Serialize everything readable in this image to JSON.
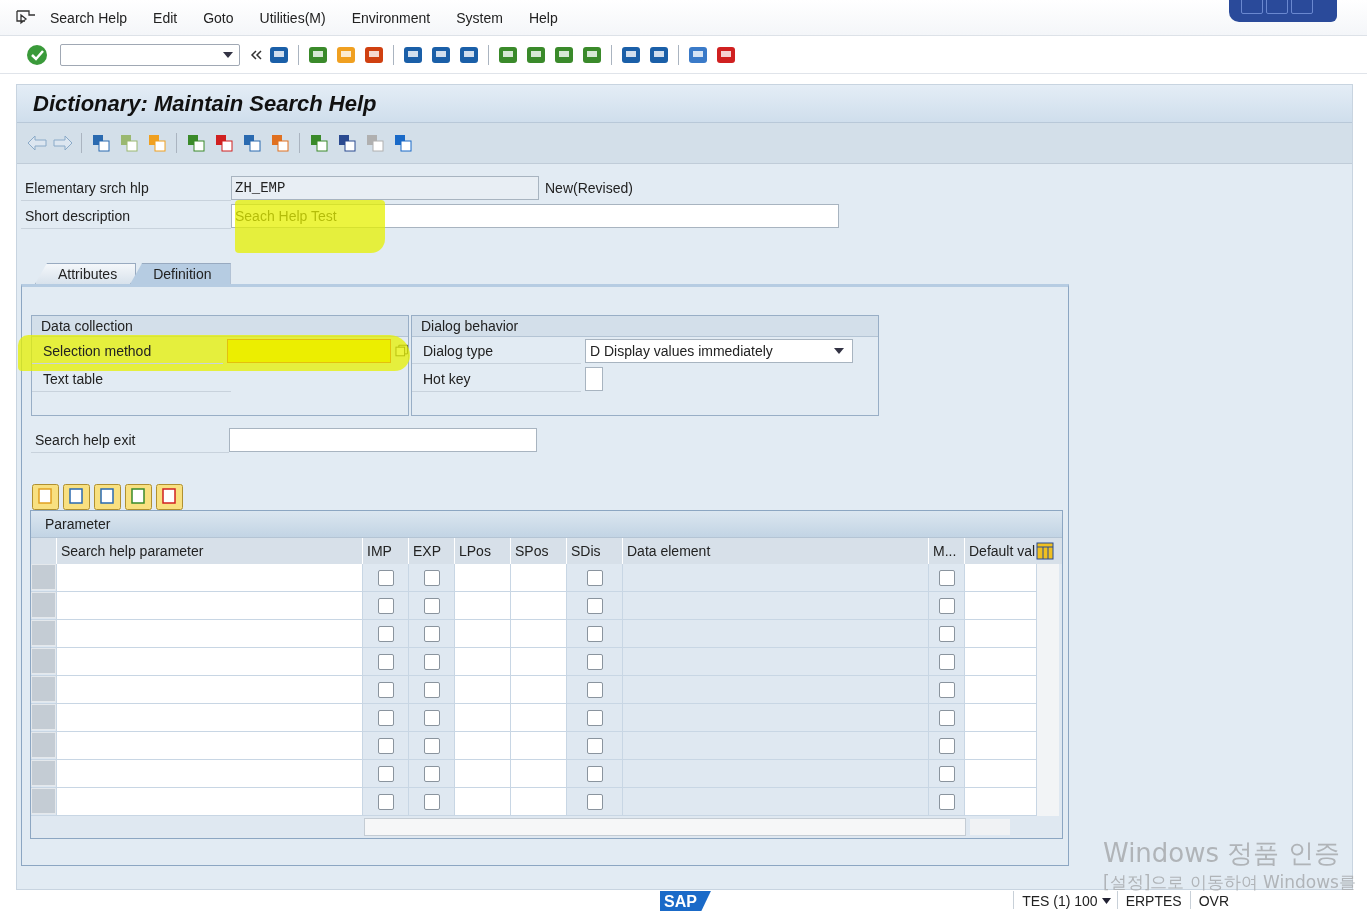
{
  "menu": [
    "Search Help",
    "Edit",
    "Goto",
    "Utilities(M)",
    "Environment",
    "System",
    "Help"
  ],
  "title": "Dictionary: Maintain Search Help",
  "header": {
    "name_label": "Elementary srch hlp",
    "name_value": "ZH_EMP",
    "status": "New(Revised)",
    "desc_label": "Short description",
    "desc_value": "Seach Help Test"
  },
  "tabs": [
    {
      "label": "Attributes",
      "selected": false
    },
    {
      "label": "Definition",
      "selected": true
    }
  ],
  "data_collection": {
    "title": "Data collection",
    "selection_label": "Selection method",
    "text_table_label": "Text table"
  },
  "dialog_behavior": {
    "title": "Dialog behavior",
    "type_label": "Dialog type",
    "type_value": "D Display values immediately",
    "hotkey_label": "Hot key"
  },
  "exit_label": "Search help exit",
  "table": {
    "title": "Parameter",
    "columns": [
      "Search help parameter",
      "IMP",
      "EXP",
      "LPos",
      "SPos",
      "SDis",
      "Data element",
      "M...",
      "Default val"
    ],
    "rows": [
      {
        "imp": false,
        "exp": false,
        "sdis": false,
        "m": false
      },
      {
        "imp": false,
        "exp": false,
        "sdis": false,
        "m": false
      },
      {
        "imp": false,
        "exp": false,
        "sdis": false,
        "m": false
      },
      {
        "imp": false,
        "exp": false,
        "sdis": false,
        "m": false
      },
      {
        "imp": false,
        "exp": false,
        "sdis": false,
        "m": false
      },
      {
        "imp": false,
        "exp": false,
        "sdis": false,
        "m": false
      },
      {
        "imp": false,
        "exp": false,
        "sdis": false,
        "m": false
      },
      {
        "imp": false,
        "exp": false,
        "sdis": false,
        "m": false
      },
      {
        "imp": false,
        "exp": false,
        "sdis": false,
        "m": false
      }
    ]
  },
  "status_bar": {
    "logo": "SAP",
    "system": "TES (1) 100",
    "server": "ERPTES",
    "mode": "OVR"
  },
  "overlay": {
    "line_1": "Windows 정품 인증",
    "line_2": "[설정]으로 이동하여 Windows를"
  }
}
